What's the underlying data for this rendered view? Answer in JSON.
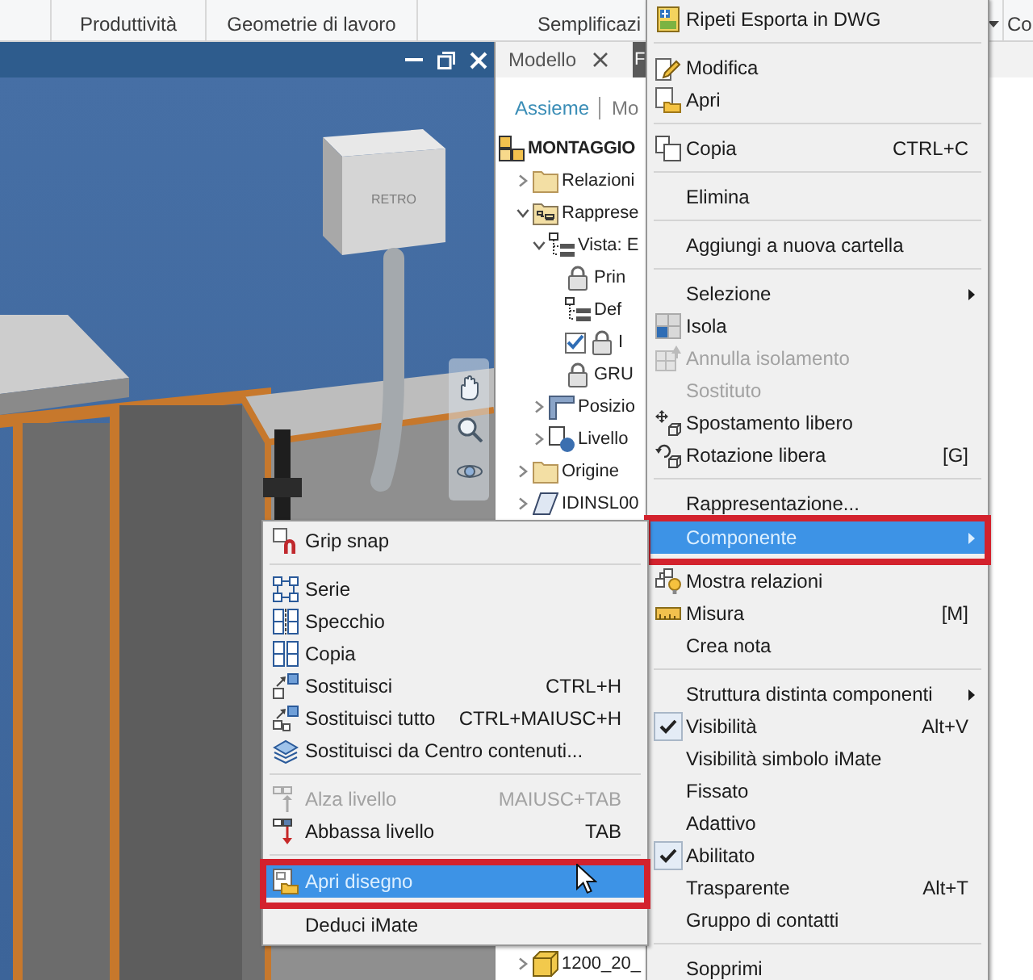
{
  "ribbon": {
    "panels": [
      {
        "label": "Produttività",
        "dropdown": false
      },
      {
        "label": "Geometrie di lavoro",
        "dropdown": false
      },
      {
        "label": "Semplificazi",
        "dropdown": true
      },
      {
        "label": "Co",
        "dropdown": false
      }
    ]
  },
  "viewport": {
    "model_label": "RETRO"
  },
  "browser": {
    "tabs": [
      {
        "label": "Modello",
        "selected": true
      },
      {
        "label": "F",
        "selected": false
      }
    ],
    "modes": [
      {
        "label": "Assieme",
        "selected": true
      },
      {
        "label": "Mo",
        "selected": false
      }
    ],
    "tree": [
      {
        "label": "MONTAGGIO",
        "children": [
          {
            "label": "Relazioni",
            "expanded": false
          },
          {
            "label": "Rapprese",
            "expanded": true,
            "children": [
              {
                "label": "Vista: E",
                "expanded": true,
                "children": [
                  {
                    "label": "Prin"
                  },
                  {
                    "label": "Def"
                  },
                  {
                    "label": "I",
                    "checked": true
                  },
                  {
                    "label": "GRU"
                  }
                ]
              },
              {
                "label": "Posizio",
                "expanded": false
              },
              {
                "label": "Livello",
                "expanded": false
              }
            ]
          },
          {
            "label": "Origine",
            "expanded": false
          },
          {
            "label": "IDINSL00",
            "expanded": false
          }
        ]
      }
    ],
    "tree_bottom": [
      {
        "label": "1200_20_",
        "expanded": false
      }
    ]
  },
  "context_menu": {
    "items": [
      {
        "kind": "command",
        "label": "Ripeti Esporta in DWG",
        "selected": false,
        "disabled": false,
        "checked": false
      },
      {
        "kind": "separator"
      },
      {
        "kind": "command",
        "label": "Modifica",
        "selected": false,
        "disabled": false,
        "checked": false
      },
      {
        "kind": "command",
        "label": "Apri",
        "selected": false,
        "disabled": false,
        "checked": false
      },
      {
        "kind": "separator"
      },
      {
        "kind": "command",
        "label": "Copia",
        "shortcut": "CTRL+C",
        "selected": false,
        "disabled": false,
        "checked": false
      },
      {
        "kind": "separator"
      },
      {
        "kind": "command",
        "label": "Elimina",
        "selected": false,
        "disabled": false,
        "checked": false
      },
      {
        "kind": "separator"
      },
      {
        "kind": "command",
        "label": "Aggiungi a nuova cartella",
        "selected": false,
        "disabled": false,
        "checked": false
      },
      {
        "kind": "separator"
      },
      {
        "kind": "submenu",
        "label": "Selezione",
        "selected": false,
        "disabled": false,
        "checked": false
      },
      {
        "kind": "command",
        "label": "Isola",
        "selected": false,
        "disabled": false,
        "checked": false
      },
      {
        "kind": "command",
        "label": "Annulla isolamento",
        "selected": false,
        "disabled": true,
        "checked": false
      },
      {
        "kind": "command",
        "label": "Sostituto",
        "selected": false,
        "disabled": true,
        "checked": false
      },
      {
        "kind": "command",
        "label": "Spostamento libero",
        "selected": false,
        "disabled": false,
        "checked": false
      },
      {
        "kind": "command",
        "label": "Rotazione libera",
        "shortcut": "[G]",
        "selected": false,
        "disabled": false,
        "checked": false
      },
      {
        "kind": "separator"
      },
      {
        "kind": "command",
        "label": "Rappresentazione...",
        "selected": false,
        "disabled": false,
        "checked": false
      },
      {
        "kind": "submenu",
        "label": "Componente",
        "selected": true,
        "disabled": false,
        "checked": false,
        "outlined": true
      },
      {
        "kind": "command",
        "label": "Mostra relazioni",
        "selected": false,
        "disabled": false,
        "checked": false
      },
      {
        "kind": "command",
        "label": "Misura",
        "shortcut": "[M]",
        "selected": false,
        "disabled": false,
        "checked": false
      },
      {
        "kind": "command",
        "label": "Crea nota",
        "selected": false,
        "disabled": false,
        "checked": false
      },
      {
        "kind": "separator"
      },
      {
        "kind": "submenu",
        "label": "Struttura distinta componenti",
        "selected": false,
        "disabled": false,
        "checked": false
      },
      {
        "kind": "command",
        "label": "Visibilità",
        "shortcut": "Alt+V",
        "selected": false,
        "disabled": false,
        "checked": true
      },
      {
        "kind": "command",
        "label": "Visibilità simbolo iMate",
        "selected": false,
        "disabled": false,
        "checked": false
      },
      {
        "kind": "command",
        "label": "Fissato",
        "selected": false,
        "disabled": false,
        "checked": false
      },
      {
        "kind": "command",
        "label": "Adattivo",
        "selected": false,
        "disabled": false,
        "checked": false
      },
      {
        "kind": "command",
        "label": "Abilitato",
        "selected": false,
        "disabled": false,
        "checked": true
      },
      {
        "kind": "command",
        "label": "Trasparente",
        "shortcut": "Alt+T",
        "selected": false,
        "disabled": false,
        "checked": false
      },
      {
        "kind": "command",
        "label": "Gruppo di contatti",
        "selected": false,
        "disabled": false,
        "checked": false
      },
      {
        "kind": "separator"
      },
      {
        "kind": "command",
        "label": "Sopprimi",
        "selected": false,
        "disabled": false,
        "checked": false
      }
    ]
  },
  "submenu": {
    "items": [
      {
        "kind": "command",
        "label": "Grip snap",
        "selected": false,
        "disabled": false
      },
      {
        "kind": "separator"
      },
      {
        "kind": "command",
        "label": "Serie",
        "selected": false,
        "disabled": false
      },
      {
        "kind": "command",
        "label": "Specchio",
        "selected": false,
        "disabled": false
      },
      {
        "kind": "command",
        "label": "Copia",
        "selected": false,
        "disabled": false
      },
      {
        "kind": "command",
        "label": "Sostituisci",
        "shortcut": "CTRL+H",
        "selected": false,
        "disabled": false
      },
      {
        "kind": "command",
        "label": "Sostituisci tutto",
        "shortcut": "CTRL+MAIUSC+H",
        "selected": false,
        "disabled": false
      },
      {
        "kind": "command",
        "label": "Sostituisci da Centro contenuti...",
        "selected": false,
        "disabled": false
      },
      {
        "kind": "separator"
      },
      {
        "kind": "command",
        "label": "Alza livello",
        "shortcut": "MAIUSC+TAB",
        "selected": false,
        "disabled": true
      },
      {
        "kind": "command",
        "label": "Abbassa livello",
        "shortcut": "TAB",
        "selected": false,
        "disabled": false
      },
      {
        "kind": "separator"
      },
      {
        "kind": "command",
        "label": "Apri disegno",
        "selected": true,
        "disabled": false,
        "outlined": true
      },
      {
        "kind": "command",
        "label": "Deduci iMate",
        "selected": false,
        "disabled": false
      }
    ]
  }
}
